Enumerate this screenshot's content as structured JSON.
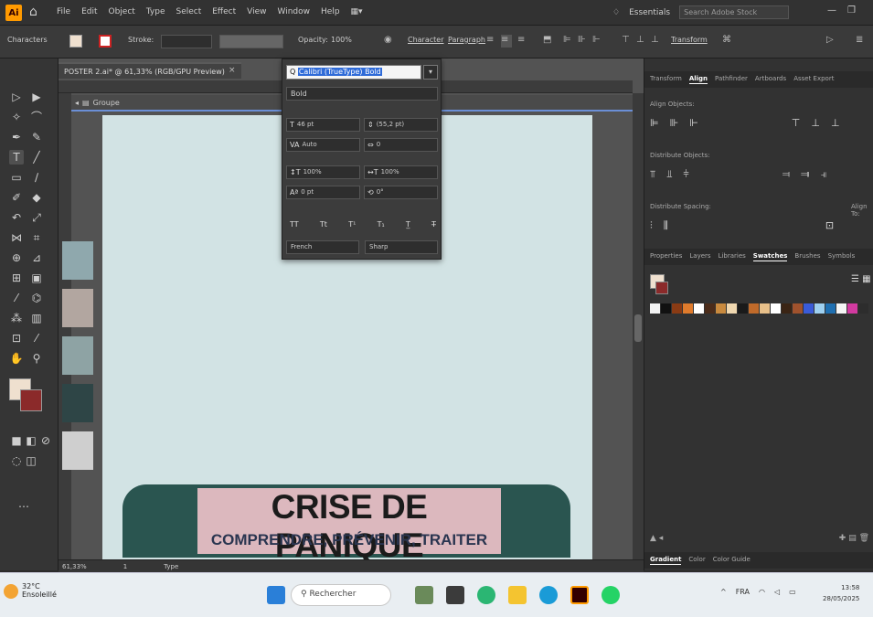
{
  "menubar": {
    "logo": "Ai",
    "items": [
      "File",
      "Edit",
      "Object",
      "Type",
      "Select",
      "Effect",
      "View",
      "Window",
      "Help"
    ],
    "workspace": "Essentials",
    "search_placeholder": "Search Adobe Stock"
  },
  "controlbar": {
    "label": "Characters",
    "stroke_label": "Stroke:",
    "opacity_label": "Opacity:",
    "opacity_value": "100%",
    "character_label": "Character",
    "paragraph_label": "Paragraph",
    "transform_label": "Transform"
  },
  "document": {
    "tab_title": "POSTER 2.ai* @ 61,33% (RGB/GPU Preview)",
    "edit_strip": "Groupe",
    "poster_title": "CRISE DE PANIQUE",
    "poster_subtitle": "COMPRENDRE, PRÉVENIR, TRAITER",
    "zoom": "61,33%",
    "page": "1",
    "tool_label": "Type"
  },
  "char_panel": {
    "font_value": "Calibri (TrueType) Bold",
    "font_search_prefix": "Q",
    "style": "Bold",
    "size": "46 pt",
    "leading": "(55,2 pt)",
    "kerning": "Auto",
    "tracking": "0",
    "vscale": "100%",
    "hscale": "100%",
    "baseline": "0 pt",
    "rotation": "0°",
    "caps": [
      "TT",
      "Tt",
      "T¹",
      "T₁",
      "T̲",
      "T̶"
    ],
    "language": "French",
    "antialias": "Sharp"
  },
  "right_panel": {
    "top_tabs": [
      "Transform",
      "Align",
      "Pathfinder",
      "Artboards",
      "Asset Export"
    ],
    "align_objects": "Align Objects:",
    "distribute_objects": "Distribute Objects:",
    "distribute_spacing": "Distribute Spacing:",
    "align_to": "Align To:",
    "lower_tabs": [
      "Properties",
      "Layers",
      "Libraries",
      "Swatches",
      "Brushes",
      "Symbols"
    ],
    "bottom_tabs": [
      "Gradient",
      "Color",
      "Color Guide"
    ]
  },
  "taskbar": {
    "temperature": "32°C",
    "weather_text": "Ensoleillé",
    "search_placeholder": "Rechercher",
    "lang": "FRA",
    "time": "13:58",
    "date": "28/05/2025"
  },
  "colors": {
    "artboard": "#d2e3e4",
    "banner": "#2a5550",
    "title_bg": "#dcb8be",
    "swatches": [
      "#f2f2f2",
      "#111111",
      "#8a3b14",
      "#e07b2c",
      "#ffffff",
      "#4b2c1a",
      "#c98a3e",
      "#f0d8b0",
      "#1a1a1a",
      "#c06a2a",
      "#e8c08a",
      "#ffffff",
      "#3a2414",
      "#a0522d",
      "#3a5bd8",
      "#9ed0f0",
      "#1f6fb0",
      "#f5f5f5",
      "#d23aa0",
      "#2d2d2d"
    ]
  }
}
